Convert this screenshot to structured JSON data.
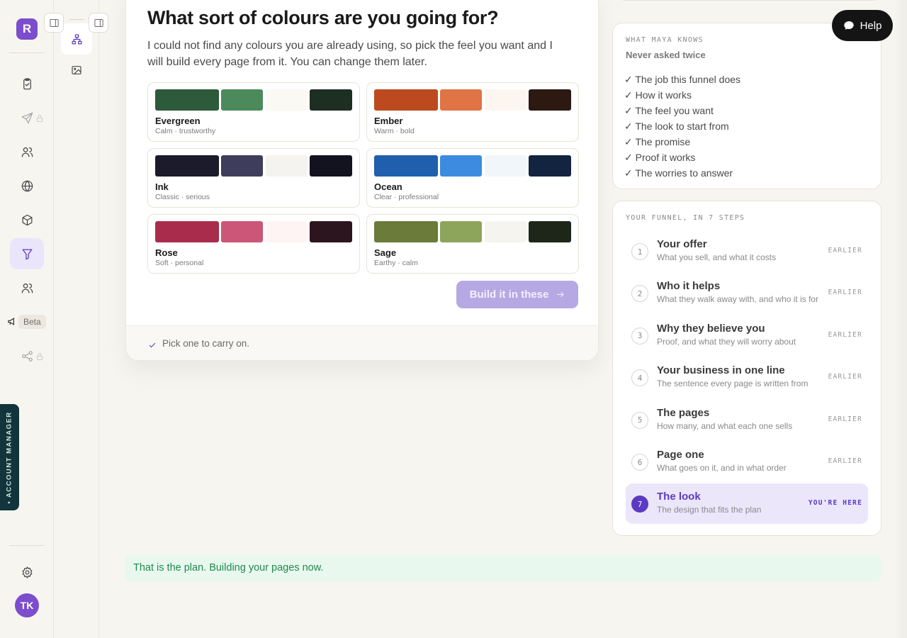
{
  "rail": {
    "logo_letter": "R",
    "beta_label": "Beta",
    "avatar_initials": "TK",
    "account_manager_label": "• ACCOUNT MANAGER"
  },
  "question": {
    "title": "What sort of colours are you going for?",
    "subtitle": "I could not find any colours you are already using, so pick the feel you want and I will build every page from it. You can change them later."
  },
  "palettes": [
    {
      "name": "Evergreen",
      "desc": "Calm · trustworthy",
      "colors": [
        "#2c5a3a",
        "#4c8a5c",
        "#fbf9f4",
        "#1d2e22"
      ]
    },
    {
      "name": "Ember",
      "desc": "Warm · bold",
      "colors": [
        "#bd4a1e",
        "#e07444",
        "#fdf6f0",
        "#2c1912"
      ]
    },
    {
      "name": "Ink",
      "desc": "Classic · serious",
      "colors": [
        "#1b1b2c",
        "#3e3d5c",
        "#f4f3ef",
        "#131320"
      ]
    },
    {
      "name": "Ocean",
      "desc": "Clear · professional",
      "colors": [
        "#1f5fae",
        "#3d8be0",
        "#f1f6fa",
        "#12243f"
      ]
    },
    {
      "name": "Rose",
      "desc": "Soft · personal",
      "colors": [
        "#aa2c4c",
        "#cc5677",
        "#fff4f4",
        "#2d1520"
      ]
    },
    {
      "name": "Sage",
      "desc": "Earthy · calm",
      "colors": [
        "#6a7b3a",
        "#8da55a",
        "#f5f4ef",
        "#1e2519"
      ]
    }
  ],
  "build_button_label": "Build it in these",
  "footer_hint": "Pick one to carry on.",
  "knows": {
    "caption": "WHAT MAYA KNOWS",
    "subtitle": "Never asked twice",
    "items": [
      "✓ The job this funnel does",
      "✓ How it works",
      "✓ The feel you want",
      "✓ The look to start from",
      "✓ The promise",
      "✓ Proof it works",
      "✓ The worries to answer"
    ]
  },
  "funnel": {
    "caption": "YOUR FUNNEL, IN 7 STEPS",
    "steps": [
      {
        "num": "1",
        "title": "Your offer",
        "desc": "What you sell, and what it costs",
        "status": "EARLIER"
      },
      {
        "num": "2",
        "title": "Who it helps",
        "desc": "What they walk away with, and who it is for",
        "status": "EARLIER"
      },
      {
        "num": "3",
        "title": "Why they believe you",
        "desc": "Proof, and what they will worry about",
        "status": "EARLIER"
      },
      {
        "num": "4",
        "title": "Your business in one line",
        "desc": "The sentence every page is written from",
        "status": "EARLIER"
      },
      {
        "num": "5",
        "title": "The pages",
        "desc": "How many, and what each one sells",
        "status": "EARLIER"
      },
      {
        "num": "6",
        "title": "Page one",
        "desc": "What goes on it, and in what order",
        "status": "EARLIER"
      },
      {
        "num": "7",
        "title": "The look",
        "desc": "The design that fits the plan",
        "status": "YOU'RE HERE"
      }
    ]
  },
  "plan_banner": "That is the plan. Building your pages now.",
  "help_label": "Help"
}
